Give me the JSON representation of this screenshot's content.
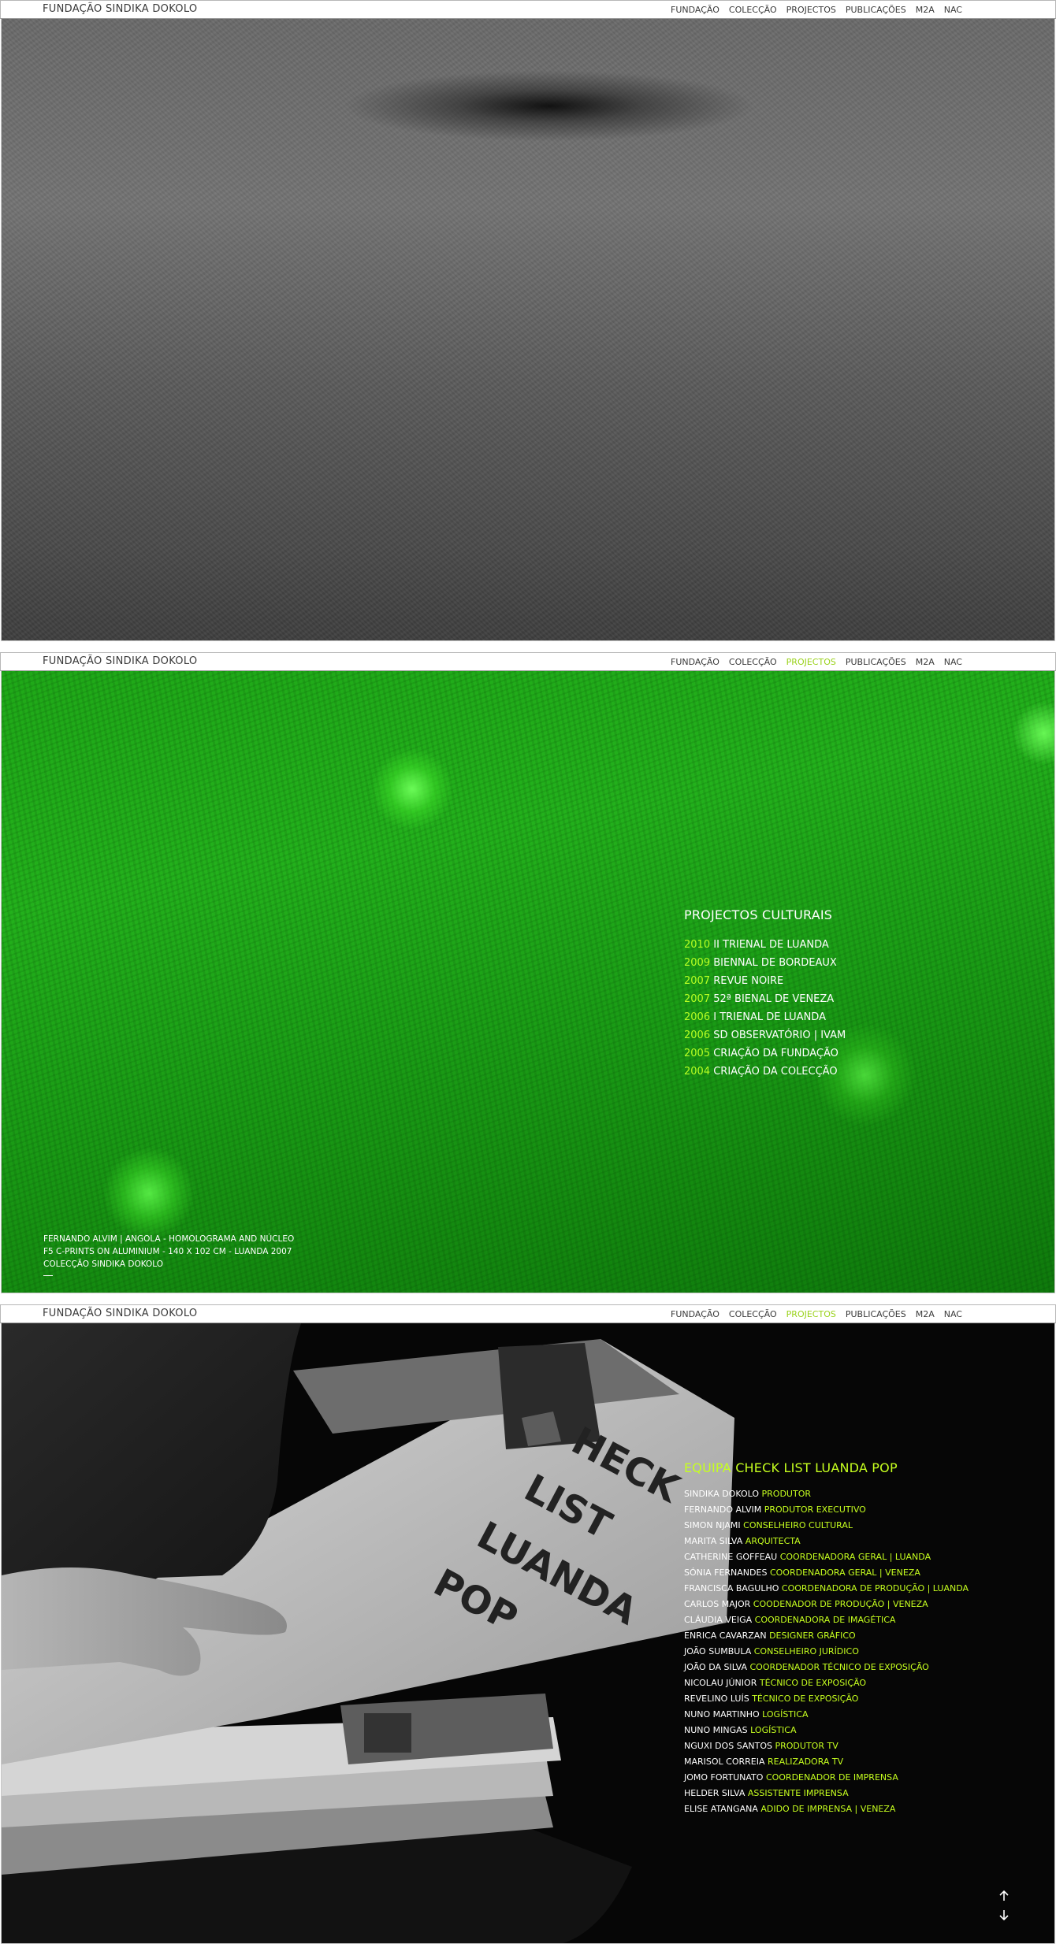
{
  "brand": "FUNDAÇÃO SINDIKA DOKOLO",
  "nav": [
    "FUNDAÇÃO",
    "COLECÇÃO",
    "PROJECTOS",
    "PUBLICAÇÕES",
    "M2A",
    "NAC"
  ],
  "section2": {
    "title": "PROJECTOS CULTURAIS",
    "projects": [
      {
        "year": "2010",
        "name": "II TRIENAL DE LUANDA"
      },
      {
        "year": "2009",
        "name": "BIENNAL DE BORDEAUX"
      },
      {
        "year": "2007",
        "name": "REVUE NOIRE"
      },
      {
        "year": "2007",
        "name": "52ª BIENAL DE VENEZA"
      },
      {
        "year": "2006",
        "name": "I TRIENAL DE LUANDA"
      },
      {
        "year": "2006",
        "name": "SD OBSERVATÓRIO | IVAM"
      },
      {
        "year": "2005",
        "name": "CRIAÇÃO DA FUNDAÇÃO"
      },
      {
        "year": "2004",
        "name": "CRIAÇÃO DA COLECÇÃO"
      }
    ],
    "caption": [
      "FERNANDO ALVIM | ANGOLA - HOMOLOGRAMA AND NÚCLEO",
      "F5 C-PRINTS ON ALUMINIUM - 140 X 102 CM - LUANDA 2007",
      "COLECÇÃO SINDIKA DOKOLO"
    ]
  },
  "section3": {
    "title": "EQUIPA CHECK LIST LUANDA POP",
    "team": [
      {
        "name": "SINDIKA DOKOLO",
        "role": "PRODUTOR"
      },
      {
        "name": "FERNANDO ALVIM",
        "role": "PRODUTOR EXECUTIVO"
      },
      {
        "name": "SIMON NJAMI",
        "role": "CONSELHEIRO CULTURAL"
      },
      {
        "name": "MARITA SILVA",
        "role": "ARQUITECTA"
      },
      {
        "name": "CATHERINE GOFFEAU",
        "role": "COORDENADORA GERAL | LUANDA"
      },
      {
        "name": "SÓNIA FERNANDES",
        "role": "COORDENADORA GERAL | VENEZA"
      },
      {
        "name": "FRANCISCA BAGULHO",
        "role": "COORDENADORA DE PRODUÇÃO | LUANDA"
      },
      {
        "name": "CARLOS MAJOR",
        "role": "COODENADOR DE PRODUÇÃO | VENEZA"
      },
      {
        "name": "CLÁUDIA VEIGA",
        "role": "COORDENADORA DE IMAGÉTICA"
      },
      {
        "name": "ENRICA CAVARZAN",
        "role": "DESIGNER GRÁFICO"
      },
      {
        "name": "JOÃO SUMBULA",
        "role": "CONSELHEIRO JURÍDICO"
      },
      {
        "name": "JOÃO DA SILVA",
        "role": "COORDENADOR TÉCNICO DE EXPOSIÇÃO"
      },
      {
        "name": "NICOLAU JÚNIOR",
        "role": "TÉCNICO DE EXPOSIÇÃO"
      },
      {
        "name": "REVELINO LUÍS",
        "role": "TÉCNICO DE EXPOSIÇÃO"
      },
      {
        "name": "NUNO MARTINHO",
        "role": "LOGÍSTICA"
      },
      {
        "name": "NUNO MINGAS",
        "role": "LOGÍSTICA"
      },
      {
        "name": "NGUXI DOS SANTOS",
        "role": "PRODUTOR TV"
      },
      {
        "name": "MARISOL CORREIA",
        "role": "REALIZADORA TV"
      },
      {
        "name": "JOMO FORTUNATO",
        "role": "COORDENADOR DE IMPRENSA"
      },
      {
        "name": "HELDER SILVA",
        "role": "ASSISTENTE IMPRENSA"
      },
      {
        "name": "ELISE ATANGANA",
        "role": "ADIDO DE IMPRENSA | VENEZA"
      }
    ],
    "magazine_text": [
      "HECK",
      "LIST",
      "LUANDA",
      "POP"
    ]
  },
  "icons": {
    "up": "arrow-up-icon",
    "down": "arrow-down-icon"
  },
  "colors": {
    "accent": "#c6ff1f",
    "year": "#b9ff24",
    "active_nav": "#9ad21a"
  }
}
